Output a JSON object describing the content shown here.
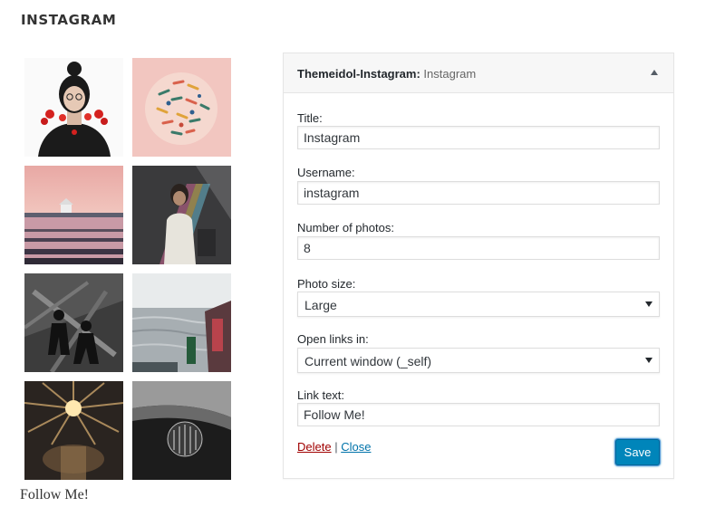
{
  "section_title": "INSTAGRAM",
  "photos": [
    {
      "name": "photo-woman-with-red-flowers"
    },
    {
      "name": "photo-circular-food-illustration"
    },
    {
      "name": "photo-pink-sunset-lake"
    },
    {
      "name": "photo-woman-rainbow-light"
    },
    {
      "name": "photo-black-white-silhouettes"
    },
    {
      "name": "photo-sea-shore-view"
    },
    {
      "name": "photo-sunburst-lamp"
    },
    {
      "name": "photo-chandelier-on-black"
    }
  ],
  "follow_link": "Follow Me!",
  "widget": {
    "title_main": "Themeidol-Instagram:",
    "title_sub": " Instagram",
    "fields": {
      "title": {
        "label": "Title:",
        "value": "Instagram"
      },
      "username": {
        "label": "Username:",
        "value": "instagram"
      },
      "number": {
        "label": "Number of photos:",
        "value": "8"
      },
      "size": {
        "label": "Photo size:",
        "value": "Large"
      },
      "target": {
        "label": "Open links in:",
        "value": "Current window (_self)"
      },
      "link": {
        "label": "Link text:",
        "value": "Follow Me!"
      }
    },
    "delete_label": "Delete",
    "separator": " | ",
    "close_label": "Close",
    "save_label": "Save"
  }
}
